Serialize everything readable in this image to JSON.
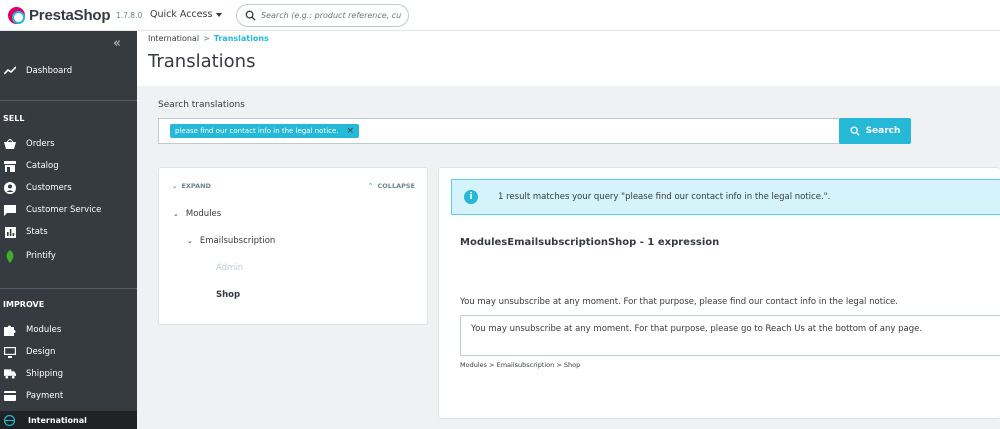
{
  "topbar": {
    "logo_text": "PrestaShop",
    "version": "1.7.8.0",
    "quick_access": "Quick Access",
    "search_placeholder": "Search (e.g.: product reference, custon"
  },
  "sidebar": {
    "collapse_icon": "double-chevron-left",
    "dashboard": "Dashboard",
    "sell_section": "SELL",
    "sell_items": [
      "Orders",
      "Catalog",
      "Customers",
      "Customer Service",
      "Stats",
      "Printify"
    ],
    "improve_section": "IMPROVE",
    "improve_items": [
      "Modules",
      "Design",
      "Shipping",
      "Payment"
    ],
    "active_item": "International"
  },
  "header": {
    "breadcrumb_parent": "International",
    "breadcrumb_current": "Translations",
    "title": "Translations"
  },
  "search": {
    "label": "Search translations",
    "tag": "please find our contact info in the legal notice.",
    "button": "Search"
  },
  "tree": {
    "expand": "EXPAND",
    "collapse": "COLLAPSE",
    "level1": "Modules",
    "level2": "Emailsubscription",
    "leaf_admin": "Admin",
    "leaf_shop": "Shop"
  },
  "results": {
    "alert": "1 result matches your query \"please find our contact info in the legal notice.\".",
    "domain_title": "ModulesEmailsubscriptionShop - 1 expression",
    "source_text": "You may unsubscribe at any moment. For that purpose, please find our contact info in the legal notice.",
    "translation_value": "You may unsubscribe at any moment. For that purpose, please go to Reach Us at the bottom of any page.",
    "path": "Modules > Emailsubscription > Shop"
  },
  "colors": {
    "brand": "#df0067",
    "accent": "#25b9d7",
    "sidebar_bg": "#363a41"
  }
}
